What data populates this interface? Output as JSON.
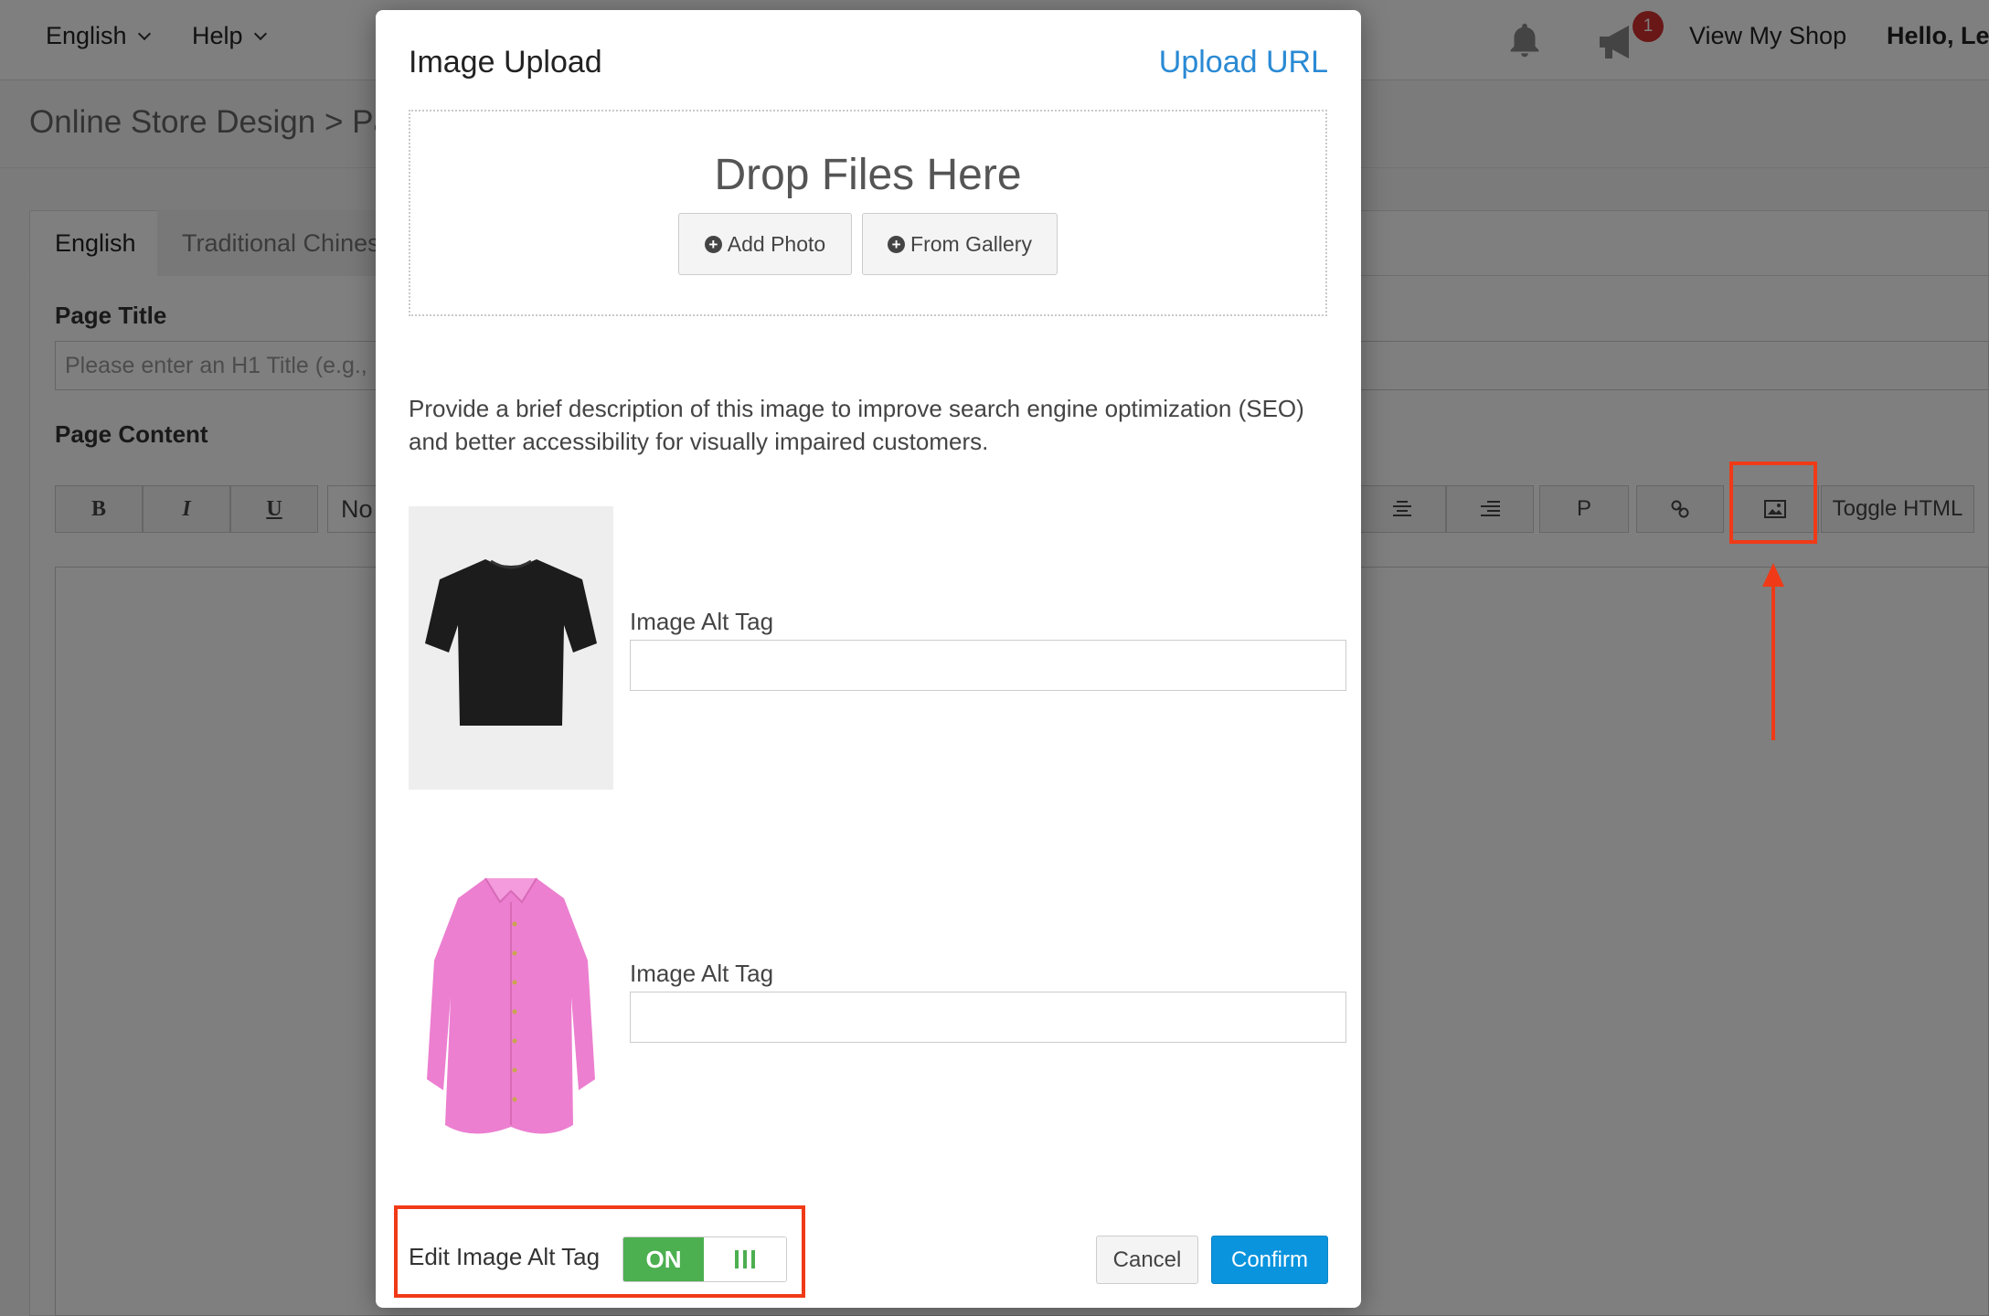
{
  "topbar": {
    "language": "English",
    "help": "Help",
    "notification_count": "1",
    "view_shop": "View My Shop",
    "greeting": "Hello, Lev"
  },
  "breadcrumb": "Online Store Design  >  Pag",
  "tabs": {
    "english": "English",
    "traditional_chinese": "Traditional Chinese"
  },
  "form": {
    "page_title_label": "Page Title",
    "page_title_placeholder": "Please enter an H1 Title (e.g.,",
    "page_content_label": "Page Content"
  },
  "toolbar": {
    "bold": "B",
    "italic": "I",
    "underline": "U",
    "format_select": "No",
    "paragraph": "P",
    "toggle_html": "Toggle HTML"
  },
  "modal": {
    "title": "Image Upload",
    "upload_url": "Upload URL",
    "drop_text": "Drop Files Here",
    "add_photo": "Add Photo",
    "from_gallery": "From Gallery",
    "description": "Provide a brief description of this image to improve search engine optimization (SEO) and better accessibility for visually impaired customers.",
    "images": [
      {
        "alt_label": "Image Alt Tag",
        "alt_value": "",
        "color": "#1c1c1c"
      },
      {
        "alt_label": "Image Alt Tag",
        "alt_value": "",
        "color": "#ec7fd0"
      }
    ],
    "edit_alt_label": "Edit Image Alt Tag",
    "toggle_state": "ON",
    "cancel": "Cancel",
    "confirm": "Confirm"
  },
  "colors": {
    "accent_blue": "#0a94de",
    "link_blue": "#2a8ad4",
    "toggle_green": "#4caf50",
    "annotation_red": "#f03a17"
  }
}
